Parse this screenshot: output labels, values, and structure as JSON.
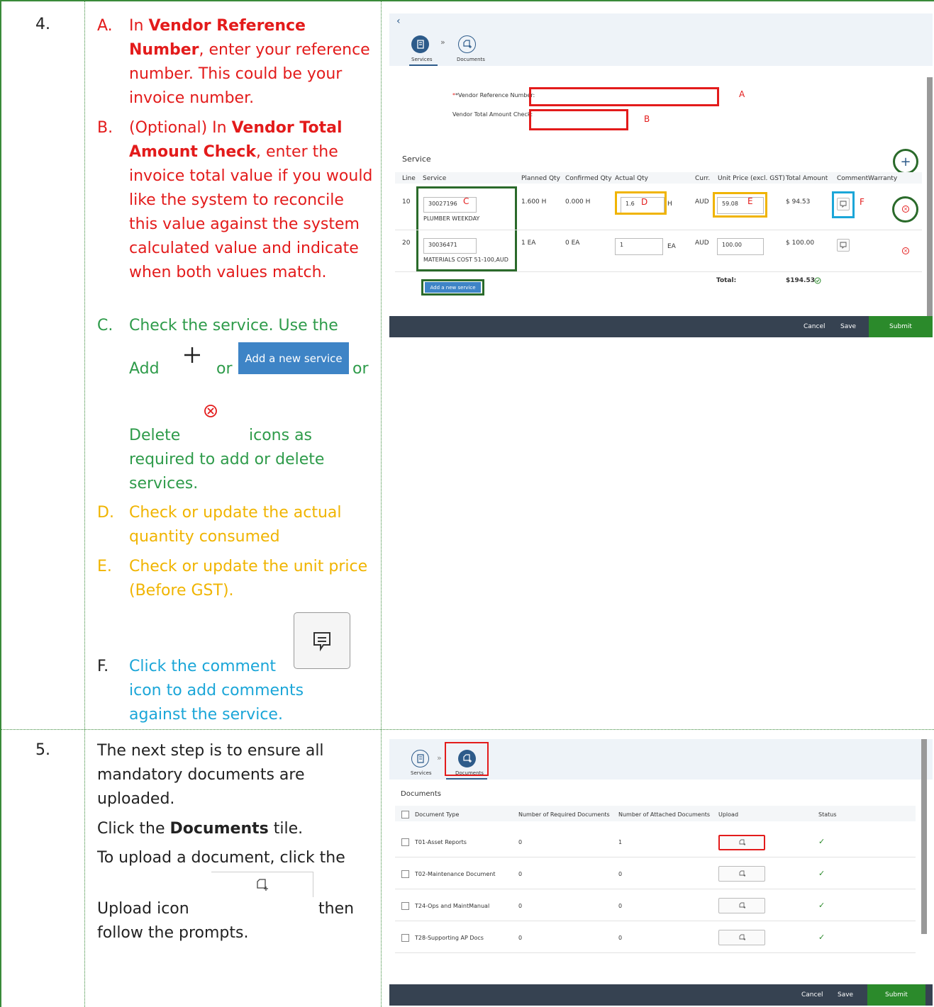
{
  "step4": {
    "number": "4.",
    "a_letter": "A.",
    "a_pre": "In ",
    "a_bold": "Vendor Reference Number",
    "a_post": ", enter your reference number. This could be your invoice number.",
    "b_letter": "B.",
    "b_pre": "(Optional) In ",
    "b_bold": "Vendor Total Amount Check",
    "b_post": ", enter the invoice total value if you would like the system to reconcile this value against the system calculated value and indicate when both values match.",
    "c_letter": "C.",
    "c_text1": "Check the service. Use the",
    "c_add": "Add",
    "c_or1": "or",
    "c_btn": "Add a new service",
    "c_or2": "or",
    "c_delete": "Delete",
    "c_text2": "icons as",
    "c_text3": "required to add or delete",
    "c_text4": "services.",
    "d_letter": "D.",
    "d_text": "Check or update the actual quantity consumed",
    "e_letter": "E.",
    "e_text": "Check or update the unit price (Before GST).",
    "f_letter": "F.",
    "f_text1": "Click the comment",
    "f_text2": "icon to add comments",
    "f_text3": "against the service."
  },
  "step5": {
    "number": "5.",
    "p1": "The next step is to ensure all mandatory documents are uploaded.",
    "p2_pre": "Click the ",
    "p2_bold": "Documents",
    "p2_post": " tile.",
    "p3": "To upload a document, click the",
    "p4_pre": "Upload icon",
    "p4_post": "then",
    "p5": "follow the prompts."
  },
  "shot1": {
    "tab_services": "Services",
    "tab_documents": "Documents",
    "vrn_label": "*Vendor Reference Number:",
    "vtac_label": "Vendor Total Amount Check:",
    "marks": [
      "A",
      "B",
      "C",
      "D",
      "E",
      "F"
    ],
    "section": "Service",
    "columns": [
      "Line",
      "Service",
      "Planned Qty",
      "Confirmed Qty",
      "Actual Qty",
      "Curr.",
      "Unit Price (excl. GST)",
      "Total Amount",
      "Comment",
      "Warranty"
    ],
    "rows": [
      {
        "line": "10",
        "code": "30027196",
        "desc": "PLUMBER WEEKDAY",
        "planned": "1.600 H",
        "confirmed": "0.000 H",
        "actual": "1.6",
        "unit": "H",
        "curr": "AUD",
        "price": "59.08",
        "total": "$ 94.53"
      },
      {
        "line": "20",
        "code": "30036471",
        "desc": "MATERIALS COST 51-100,AUD",
        "planned": "1 EA",
        "confirmed": "0 EA",
        "actual": "1",
        "unit": "EA",
        "curr": "AUD",
        "price": "100.00",
        "total": "$ 100.00"
      }
    ],
    "add_button": "Add a new service",
    "total_label": "Total:",
    "total_value": "$194.53",
    "cancel": "Cancel",
    "save": "Save",
    "submit": "Submit"
  },
  "shot2": {
    "tab_services": "Services",
    "tab_documents": "Documents",
    "section": "Documents",
    "columns": [
      "Document Type",
      "Number of Required Documents",
      "Number of Attached Documents",
      "Upload",
      "Status"
    ],
    "rows": [
      {
        "type": "T01-Asset Reports",
        "req": "0",
        "att": "1"
      },
      {
        "type": "T02-Maintenance Document",
        "req": "0",
        "att": "0"
      },
      {
        "type": "T24-Ops and MaintManual",
        "req": "0",
        "att": "0"
      },
      {
        "type": "T28-Supporting AP Docs",
        "req": "0",
        "att": "0"
      }
    ],
    "cancel": "Cancel",
    "save": "Save",
    "submit": "Submit"
  }
}
